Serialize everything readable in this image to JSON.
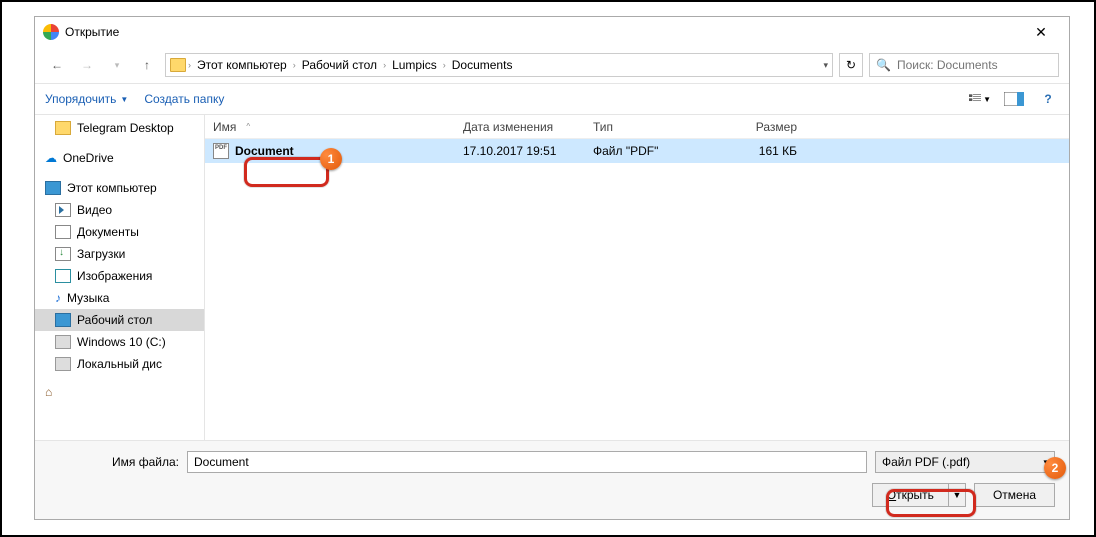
{
  "window": {
    "title": "Открытие"
  },
  "breadcrumb": {
    "root": "Этот компьютер",
    "items": [
      "Рабочий стол",
      "Lumpics",
      "Documents"
    ]
  },
  "search": {
    "placeholder": "Поиск: Documents"
  },
  "toolbar": {
    "organize": "Упорядочить",
    "newfolder": "Создать папку"
  },
  "tree": {
    "items": [
      {
        "label": "Telegram Desktop",
        "icon": "folder",
        "indent": 1
      },
      {
        "label": "OneDrive",
        "icon": "onedrive",
        "indent": 0
      },
      {
        "label": "Этот компьютер",
        "icon": "pc",
        "indent": 0
      },
      {
        "label": "Видео",
        "icon": "video",
        "indent": 1
      },
      {
        "label": "Документы",
        "icon": "docs",
        "indent": 1
      },
      {
        "label": "Загрузки",
        "icon": "down",
        "indent": 1
      },
      {
        "label": "Изображения",
        "icon": "img",
        "indent": 1
      },
      {
        "label": "Музыка",
        "icon": "music",
        "indent": 1
      },
      {
        "label": "Рабочий стол",
        "icon": "desk",
        "indent": 1,
        "selected": true
      },
      {
        "label": "Windows 10 (C:)",
        "icon": "disk",
        "indent": 1
      },
      {
        "label": "Локальный дис",
        "icon": "disk",
        "indent": 1
      }
    ]
  },
  "columns": {
    "name": "Имя",
    "date": "Дата изменения",
    "type": "Тип",
    "size": "Размер"
  },
  "files": [
    {
      "name": "Document",
      "date": "17.10.2017 19:51",
      "type": "Файл \"PDF\"",
      "size": "161 КБ"
    }
  ],
  "footer": {
    "filename_label": "Имя файла:",
    "filename_value": "Document",
    "filter": "Файл PDF (.pdf)",
    "open": "Открыть",
    "cancel": "Отмена"
  },
  "annotations": {
    "badge1": "1",
    "badge2": "2"
  }
}
